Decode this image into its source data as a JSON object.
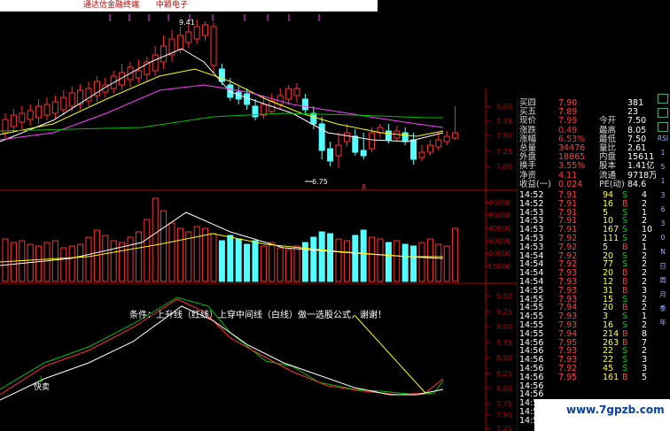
{
  "window": {
    "title_app": "通达信金融终端",
    "title_stock": "中颖电子"
  },
  "main_chart": {
    "high_label": "9.41",
    "low_label": "6.75",
    "price_axis": [
      "8.00",
      "7.75",
      "7.50",
      "7.25",
      "7.00"
    ],
    "marker": "8"
  },
  "volume_chart": {
    "axis": [
      "60000",
      "50000",
      "40000",
      "30000",
      "20000",
      "10000"
    ]
  },
  "indicator_chart": {
    "axis": [
      "9.50",
      "9.25",
      "9.00",
      "8.75",
      "8.50",
      "8.25",
      "8.00",
      "7.75",
      "7.50",
      "7.25"
    ],
    "annotation": "条件：上升线（红线）上穿中间线（白线）做一选股公式，谢谢！",
    "signal_label": "快卖"
  },
  "quote_panel": {
    "rows": [
      {
        "l1": "买四",
        "v1": "7.90",
        "l2": "",
        "v2": "381"
      },
      {
        "l1": "买五",
        "v1": "7.89",
        "l2": "",
        "v2": "23"
      },
      {
        "l1": "现价",
        "v1": "7.99",
        "l2": "今开",
        "v2": "7.50"
      },
      {
        "l1": "涨跌",
        "v1": "0.49",
        "l2": "最高",
        "v2": "8.05"
      },
      {
        "l1": "涨幅",
        "v1": "6.53%",
        "l2": "最低",
        "v2": "7.50"
      },
      {
        "l1": "总量",
        "v1": "34476",
        "l2": "量比",
        "v2": "2.61"
      },
      {
        "l1": "外盘",
        "v1": "18865",
        "l2": "内盘",
        "v2": "15611"
      },
      {
        "l1": "换手",
        "v1": "3.55%",
        "l2": "股本",
        "v2": "1.41亿"
      },
      {
        "l1": "净资",
        "v1": "4.11",
        "l2": "流通",
        "v2": "9718万"
      },
      {
        "l1": "收益(一)",
        "v1": "0.024",
        "l2": "PE(动)",
        "v2": "84.6"
      }
    ],
    "ticks": [
      {
        "t": "14:52",
        "p": "7.91",
        "v": "94",
        "d": "S",
        "n": "4"
      },
      {
        "t": "14:52",
        "p": "7.91",
        "v": "16",
        "d": "B",
        "n": "2"
      },
      {
        "t": "14:53",
        "p": "7.91",
        "v": "5",
        "d": "S",
        "n": "1"
      },
      {
        "t": "14:53",
        "p": "7.91",
        "v": "10",
        "d": "S",
        "n": "2"
      },
      {
        "t": "14:53",
        "p": "7.91",
        "v": "167",
        "d": "S",
        "n": "10"
      },
      {
        "t": "14:53",
        "p": "7.92",
        "v": "111",
        "d": "S",
        "n": "2"
      },
      {
        "t": "14:53",
        "p": "7.92",
        "v": "5",
        "d": "B",
        "n": "1"
      },
      {
        "t": "14:54",
        "p": "7.92",
        "v": "20",
        "d": "S",
        "n": "2"
      },
      {
        "t": "14:54",
        "p": "7.92",
        "v": "77",
        "d": "S",
        "n": "2"
      },
      {
        "t": "14:54",
        "p": "7.93",
        "v": "20",
        "d": "B",
        "n": "2"
      },
      {
        "t": "14:54",
        "p": "7.93",
        "v": "12",
        "d": "B",
        "n": "2"
      },
      {
        "t": "14:55",
        "p": "7.93",
        "v": "31",
        "d": "B",
        "n": "3"
      },
      {
        "t": "14:55",
        "p": "7.93",
        "v": "15",
        "d": "S",
        "n": "2"
      },
      {
        "t": "14:55",
        "p": "7.94",
        "v": "20",
        "d": "B",
        "n": "2"
      },
      {
        "t": "14:55",
        "p": "7.93",
        "v": "3",
        "d": "S",
        "n": "1"
      },
      {
        "t": "14:55",
        "p": "7.93",
        "v": "16",
        "d": "S",
        "n": "2"
      },
      {
        "t": "14:55",
        "p": "7.94",
        "v": "214",
        "d": "B",
        "n": "8"
      },
      {
        "t": "14:56",
        "p": "7.95",
        "v": "263",
        "d": "B",
        "n": "7"
      },
      {
        "t": "14:56",
        "p": "7.93",
        "v": "22",
        "d": "S",
        "n": "2"
      },
      {
        "t": "14:56",
        "p": "7.93",
        "v": "22",
        "d": "S",
        "n": "3"
      },
      {
        "t": "14:56",
        "p": "7.92",
        "v": "45",
        "d": "S",
        "n": "3"
      },
      {
        "t": "14:56",
        "p": "7.95",
        "v": "161",
        "d": "B",
        "n": "5"
      },
      {
        "t": "14:56",
        "p": "",
        "v": "",
        "d": "",
        "n": ""
      },
      {
        "t": "14:56",
        "p": "",
        "v": "",
        "d": "",
        "n": ""
      },
      {
        "t": "14:5",
        "p": "",
        "v": "",
        "d": "",
        "n": ""
      },
      {
        "t": "14:5",
        "p": "",
        "v": "",
        "d": "",
        "n": ""
      },
      {
        "t": "14:5",
        "p": "",
        "v": "",
        "d": "",
        "n": ""
      }
    ]
  },
  "sidebar": {
    "items": [
      "RSI",
      "1",
      "5",
      "1",
      "3",
      "6",
      "3",
      "0",
      "N",
      "日",
      "周",
      "月",
      "季",
      "年"
    ]
  },
  "watermark": "www.7gpzb.com",
  "colors": {
    "up": "#ff3030",
    "down": "#54ffff",
    "ma_white": "#ffffff",
    "ma_yellow": "#ffff00",
    "ma_magenta": "#ff40ff",
    "ma_green": "#00c000",
    "grid": "#b00000"
  }
}
